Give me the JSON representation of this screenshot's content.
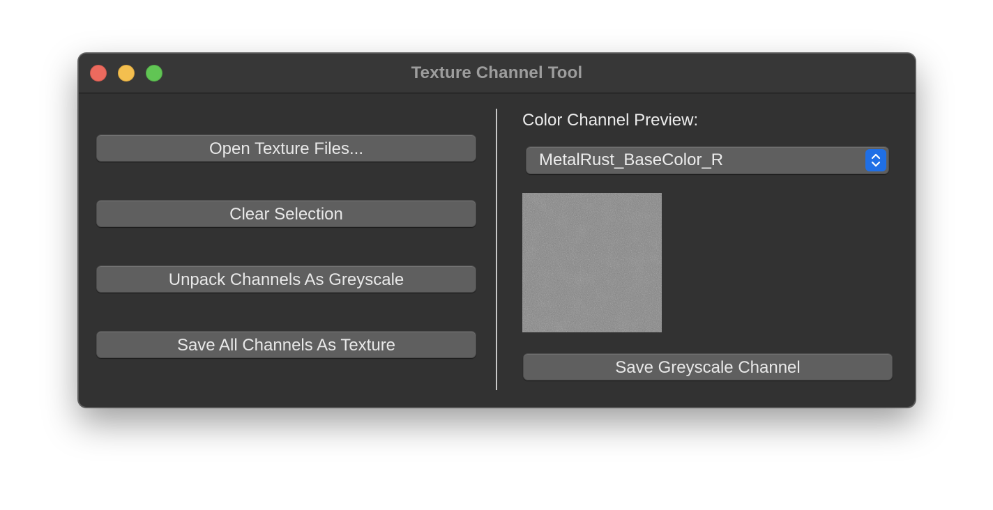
{
  "window": {
    "title": "Texture Channel Tool"
  },
  "traffic_lights": {
    "close": "#ec6a5e",
    "minimize": "#f4bf4f",
    "zoom": "#61c554"
  },
  "left_panel": {
    "buttons": [
      {
        "label": "Open Texture Files..."
      },
      {
        "label": "Clear Selection"
      },
      {
        "label": "Unpack Channels As Greyscale"
      },
      {
        "label": "Save All Channels As Texture"
      }
    ]
  },
  "right_panel": {
    "preview_label": "Color Channel Preview:",
    "channel_select": {
      "selected": "MetalRust_BaseColor_R",
      "accent": "#1f6fe6",
      "icon": "chevron-up-down-icon"
    },
    "preview_image": {
      "description_icon": "greyscale-texture-preview"
    },
    "save_button": "Save Greyscale Channel"
  },
  "colors": {
    "window_bg": "#323232",
    "button_bg": "#5f5f5f",
    "text": "#e8e8e8"
  }
}
